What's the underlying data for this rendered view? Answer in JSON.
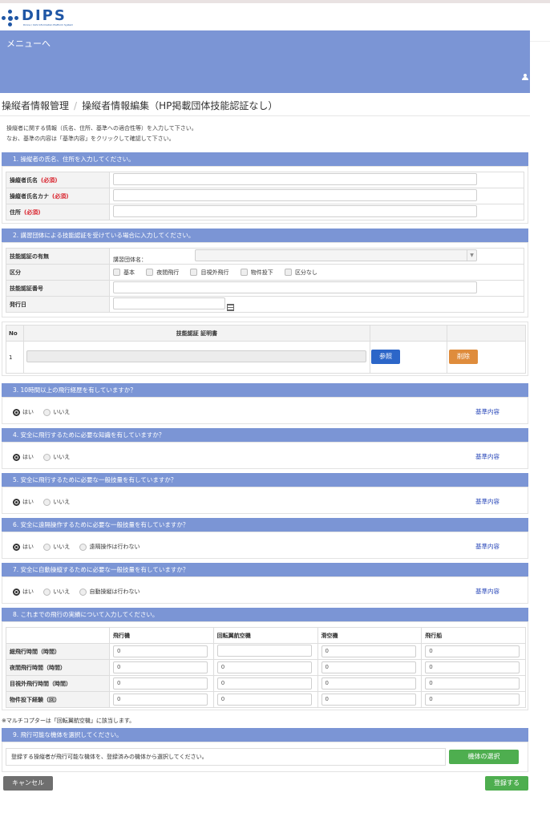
{
  "logo": {
    "text": "DIPS",
    "subtitle": "Drone / UAS Information Platform System"
  },
  "menu": {
    "label": "メニューへ"
  },
  "breadcrumb": {
    "parent": "操縦者情報管理",
    "separator": "/",
    "current": "操縦者情報編集（HP掲載団体技能認証なし）"
  },
  "intro": {
    "line1": "操縦者に関する情報（氏名、住所、基準への適合性等）を入力して下さい。",
    "line2": "なお、基準の内容は「基準内容」をクリックして確認して下さい。"
  },
  "required_mark": "(必須)",
  "section1": {
    "title": "1. 操縦者の氏名、住所を入力してください。",
    "rows": [
      {
        "label": "操縦者氏名",
        "value": ""
      },
      {
        "label": "操縦者氏名カナ",
        "value": ""
      },
      {
        "label": "住所",
        "value": ""
      }
    ]
  },
  "section2": {
    "title": "2. 講習団体による技能認証を受けている場合に入力してください。",
    "rows": {
      "has_cert": "技能認証の有無",
      "category": "区分",
      "cert_no": "技能認証番号",
      "issue_date": "発行日"
    },
    "org_label": "講習団体名：",
    "org_selected": "",
    "categories": [
      "基本",
      "夜間飛行",
      "目視外飛行",
      "物件投下",
      "区分なし"
    ],
    "cert_table": {
      "col_no": "No",
      "col_cert": "技能認証 証明書",
      "row_no": "1",
      "browse": "参照",
      "delete": "削除"
    }
  },
  "questions": [
    {
      "title": "3. 10時間以上の飛行経歴を有していますか？",
      "options": [
        "はい",
        "いいえ"
      ],
      "selected": 0,
      "link": "基準内容"
    },
    {
      "title": "4. 安全に飛行するために必要な知識を有していますか？",
      "options": [
        "はい",
        "いいえ"
      ],
      "selected": 0,
      "link": "基準内容"
    },
    {
      "title": "5. 安全に飛行するために必要な一般技量を有していますか？",
      "options": [
        "はい",
        "いいえ"
      ],
      "selected": 0,
      "link": "基準内容"
    },
    {
      "title": "6. 安全に遠隔操作するために必要な一般技量を有していますか？",
      "options": [
        "はい",
        "いいえ",
        "遠隔操作は行わない"
      ],
      "selected": 0,
      "link": "基準内容"
    },
    {
      "title": "7. 安全に自動操縦するために必要な一般技量を有していますか？",
      "options": [
        "はい",
        "いいえ",
        "自動操縦は行わない"
      ],
      "selected": 0,
      "link": "基準内容"
    }
  ],
  "section8": {
    "title": "8. これまでの飛行の実績について入力してください。",
    "columns": [
      "飛行機",
      "回転翼航空機",
      "滑空機",
      "飛行船"
    ],
    "rows": [
      {
        "label": "総飛行時間（時間）",
        "values": [
          "0",
          "",
          "0",
          "0"
        ]
      },
      {
        "label": "夜間飛行時間（時間）",
        "values": [
          "0",
          "0",
          "0",
          "0"
        ]
      },
      {
        "label": "目視外飛行時間（時間）",
        "values": [
          "0",
          "0",
          "0",
          "0"
        ]
      },
      {
        "label": "物件投下経験（回）",
        "values": [
          "0",
          "0",
          "0",
          "0"
        ]
      }
    ],
    "note": "※マルチコプターは「回転翼航空機」に該当します。"
  },
  "section9": {
    "title": "9. 飛行可能な機体を選択してください。",
    "description": "登録する操縦者が飛行可能な機体を、登録済みの機体から選択してください。",
    "select_button": "機体の選択"
  },
  "footer": {
    "cancel": "キャンセル",
    "register": "登録する"
  },
  "colors": {
    "header": "#7b95d5",
    "link": "#2a48b9",
    "green": "#4eae4f",
    "orange": "#df8c3c",
    "blue": "#2c66c8",
    "required": "#d9232d"
  }
}
